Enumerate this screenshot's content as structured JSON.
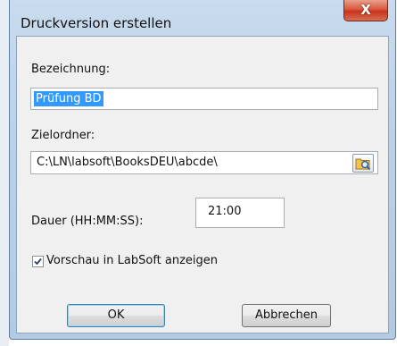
{
  "window": {
    "title": "Druckversion erstellen",
    "close_label": "X"
  },
  "form": {
    "bezeichnung_label": "Bezeichnung:",
    "bezeichnung_value": "Prüfung BD",
    "zielordner_label": "Zielordner:",
    "zielordner_value": "C:\\LN\\labsoft\\BooksDEU\\abcde\\",
    "dauer_label": "Dauer (HH:MM:SS):",
    "dauer_value": "21:00",
    "vorschau_label": "Vorschau in LabSoft anzeigen",
    "vorschau_checked": true
  },
  "buttons": {
    "ok_label": "OK",
    "cancel_label": "Abbrechen"
  },
  "icons": {
    "browse": "folder-browse-icon",
    "check": "checkmark-icon"
  }
}
